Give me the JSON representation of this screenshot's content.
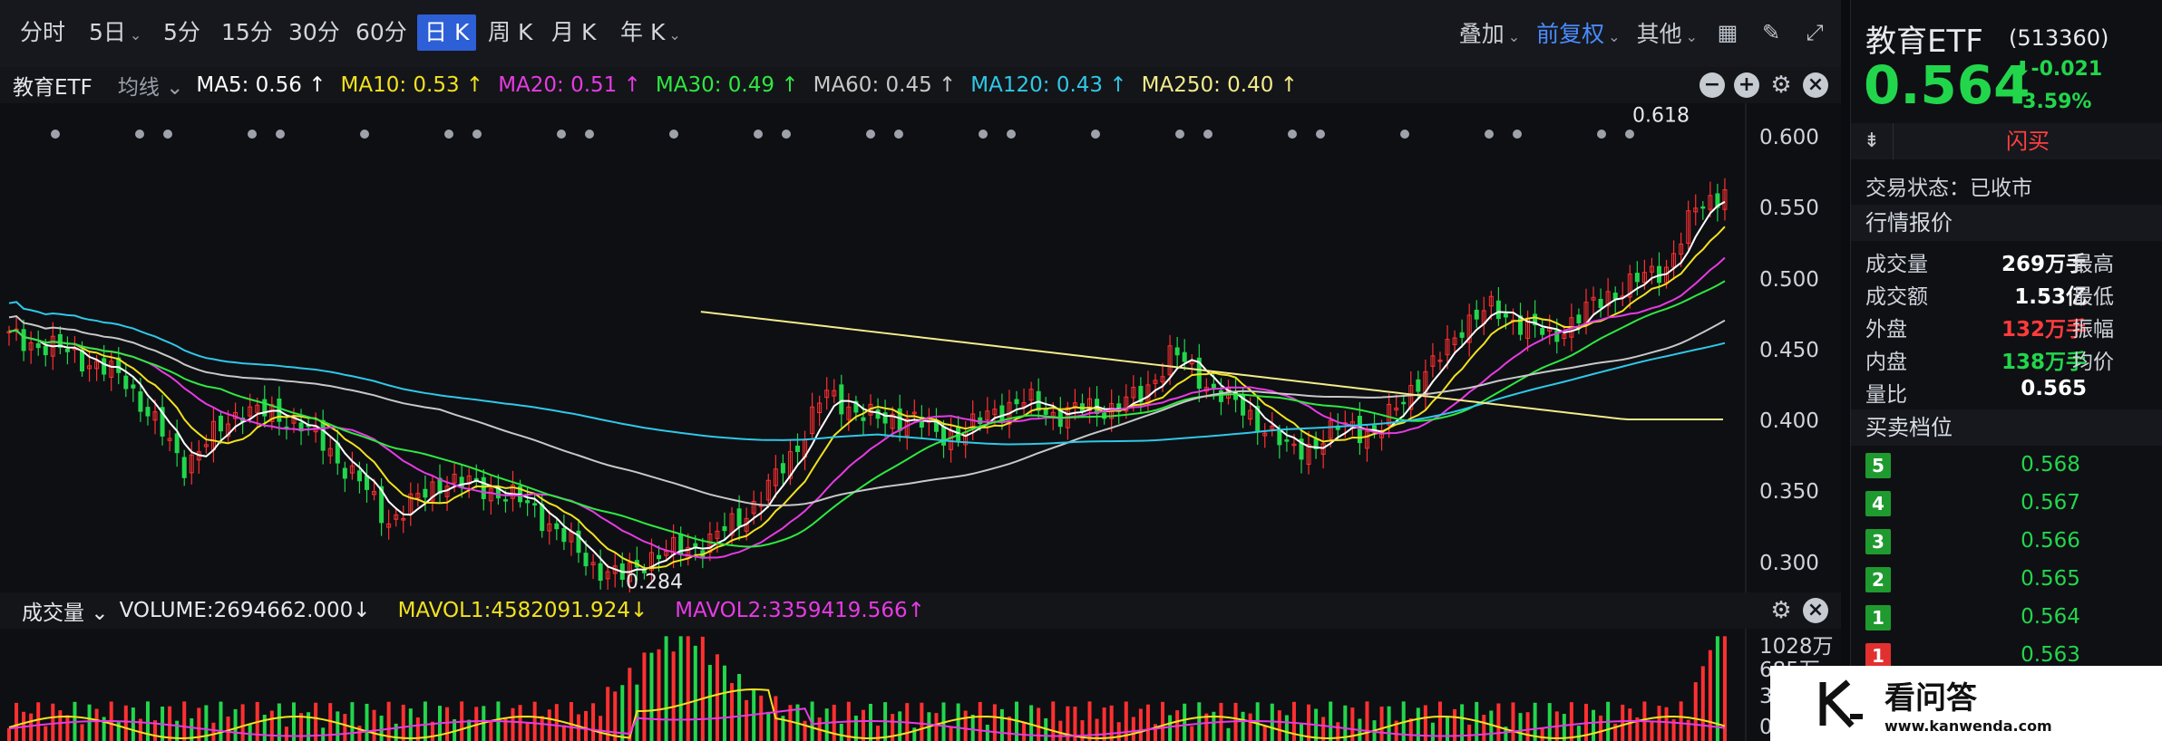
{
  "toolbar": {
    "periods": [
      "分时",
      "5日",
      "5分",
      "15分",
      "30分",
      "60分",
      "日 K",
      "周 K",
      "月 K",
      "年 K"
    ],
    "active_period": "日 K",
    "overlay_label": "叠加",
    "adjust_label": "前复权",
    "other_label": "其他"
  },
  "ma_legend": {
    "name": "教育ETF",
    "type": "均线",
    "items": [
      {
        "label": "MA5: 0.56 ↑",
        "color": "#ffffff"
      },
      {
        "label": "MA10: 0.53 ↑",
        "color": "#f2e21f"
      },
      {
        "label": "MA20: 0.51 ↑",
        "color": "#e63be3"
      },
      {
        "label": "MA30: 0.49 ↑",
        "color": "#2ee842"
      },
      {
        "label": "MA60: 0.45 ↑",
        "color": "#c8c8c8"
      },
      {
        "label": "MA120: 0.43 ↑",
        "color": "#2fc8e8"
      },
      {
        "label": "MA250: 0.40 ↑",
        "color": "#f2ec8a"
      }
    ]
  },
  "price_axis": [
    "0.600",
    "0.550",
    "0.500",
    "0.450",
    "0.400",
    "0.350",
    "0.300"
  ],
  "annotations": {
    "high": "0.618",
    "low": "0.284"
  },
  "volume_legend": {
    "name": "成交量",
    "volume": "VOLUME:2694662.000↓",
    "mavol1": "MAVOL1:4582091.924↓",
    "mavol2": "MAVOL2:3359419.566↑"
  },
  "volume_axis": [
    "1028万",
    "685万",
    "34",
    "0"
  ],
  "panel": {
    "name": "教育ETF",
    "code": "(513360)",
    "price": "0.564",
    "change": "-0.021",
    "change_pct": "-3.59%",
    "flash_buy": "闪买",
    "status": "交易状态：已收市",
    "quote_title": "行情报价",
    "quotes": [
      {
        "label": "成交量",
        "value": "269万手",
        "label2": "最高",
        "color": "#ffffff"
      },
      {
        "label": "成交额",
        "value": "1.53亿",
        "label2": "最低",
        "color": "#ffffff"
      },
      {
        "label": "外盘",
        "value": "132万手",
        "label2": "振幅",
        "color": "#ff3b3b"
      },
      {
        "label": "内盘",
        "value": "138万手",
        "label2": "均价",
        "color": "#22d64c"
      },
      {
        "label": "量比",
        "value": "0.565",
        "label2": "",
        "color": "#ffffff"
      }
    ],
    "depth_title": "买卖档位",
    "levels": [
      {
        "n": "5",
        "price": "0.568",
        "color": "#1f9a2f"
      },
      {
        "n": "4",
        "price": "0.567",
        "color": "#1f9a2f"
      },
      {
        "n": "3",
        "price": "0.566",
        "color": "#1f9a2f"
      },
      {
        "n": "2",
        "price": "0.565",
        "color": "#1f9a2f"
      },
      {
        "n": "1",
        "price": "0.564",
        "color": "#1f9a2f"
      },
      {
        "n": "1",
        "price": "0.563",
        "color": "#e23030"
      }
    ]
  },
  "watermark": {
    "brand": "看问答",
    "url": "www.kanwenda.com"
  },
  "chart_data": {
    "type": "candlestick",
    "title": "教育ETF",
    "ylim": [
      0.28,
      0.625
    ],
    "high": 0.618,
    "low": 0.284,
    "close_path": [
      0.46,
      0.455,
      0.45,
      0.44,
      0.43,
      0.4,
      0.37,
      0.39,
      0.41,
      0.405,
      0.4,
      0.38,
      0.36,
      0.33,
      0.345,
      0.36,
      0.355,
      0.35,
      0.34,
      0.32,
      0.3,
      0.29,
      0.305,
      0.31,
      0.315,
      0.33,
      0.35,
      0.38,
      0.42,
      0.41,
      0.4,
      0.405,
      0.39,
      0.395,
      0.41,
      0.415,
      0.405,
      0.41,
      0.41,
      0.42,
      0.45,
      0.43,
      0.415,
      0.4,
      0.38,
      0.385,
      0.4,
      0.39,
      0.42,
      0.44,
      0.47,
      0.48,
      0.47,
      0.46,
      0.475,
      0.49,
      0.5,
      0.51,
      0.55,
      0.564
    ]
  }
}
